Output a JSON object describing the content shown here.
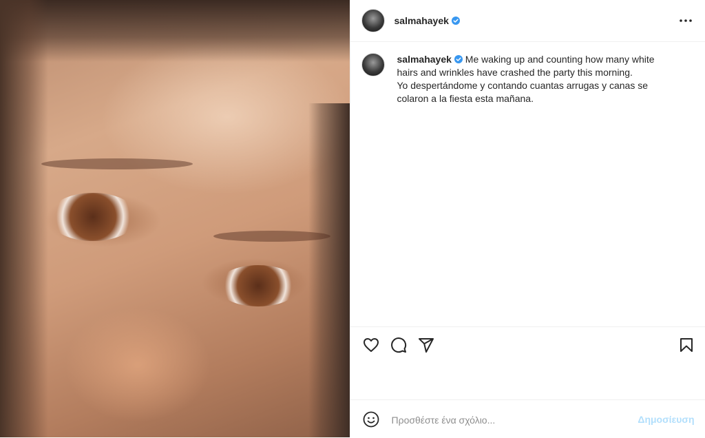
{
  "post": {
    "username": "salmahayek",
    "verified_icon": "verified-badge-icon",
    "more_icon": "more-options-icon"
  },
  "caption": {
    "username": "salmahayek",
    "lines": [
      "Me waking up and counting how many white",
      "hairs and wrinkles have crashed the party this morning.",
      "Yo despertándome y contando cuantas arrugas y canas se",
      "colaron a la fiesta esta mañana."
    ]
  },
  "actions": {
    "like_icon": "heart-icon",
    "comment_icon": "comment-icon",
    "share_icon": "share-icon",
    "save_icon": "bookmark-icon"
  },
  "comment_box": {
    "emoji_icon": "emoji-icon",
    "placeholder": "Προσθέστε ένα σχόλιο...",
    "post_label": "Δημοσίευση"
  },
  "colors": {
    "verified": "#3897f0",
    "post_button_disabled": "#b2dffc",
    "border": "#efefef"
  }
}
